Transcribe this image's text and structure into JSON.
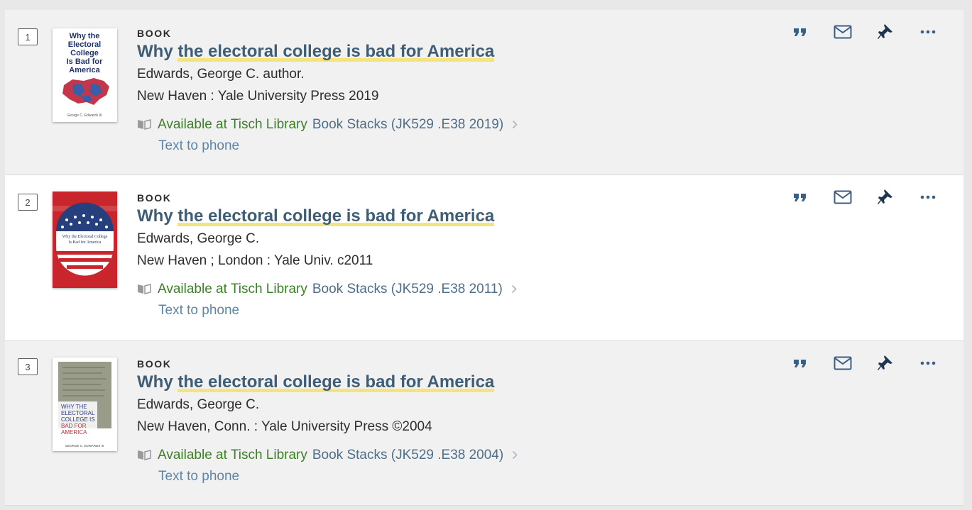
{
  "results": [
    {
      "index": "1",
      "type": "BOOK",
      "title_prefix": "Why ",
      "title_highlight": "the electoral college is bad for America",
      "author": "Edwards, George C. author.",
      "publisher": "New Haven : Yale University Press 2019",
      "availability_status": "Available at Tisch Library",
      "availability_location": "Book Stacks (JK529 .E38 2019)",
      "text_to_phone": "Text to phone"
    },
    {
      "index": "2",
      "type": "BOOK",
      "title_prefix": "Why ",
      "title_highlight": "the electoral college is bad for America",
      "author": "Edwards, George C.",
      "publisher": "New Haven ; London : Yale Univ. c2011",
      "availability_status": "Available at Tisch Library",
      "availability_location": "Book Stacks (JK529 .E38 2011)",
      "text_to_phone": "Text to phone"
    },
    {
      "index": "3",
      "type": "BOOK",
      "title_prefix": "Why ",
      "title_highlight": "the electoral college is bad for America",
      "author": "Edwards, George C.",
      "publisher": "New Haven, Conn. : Yale University Press ©2004",
      "availability_status": "Available at Tisch Library",
      "availability_location": "Book Stacks (JK529 .E38 2004)",
      "text_to_phone": "Text to phone"
    }
  ],
  "covers": {
    "c1_title": [
      "Why the",
      "Electoral",
      "College",
      "Is Bad for",
      "America"
    ],
    "c1_author": "George C. Edwards III",
    "c2_title": [
      "Why the Electoral College",
      "Is Bad for America"
    ],
    "c3_title": [
      "WHY THE",
      "ELECTORAL",
      "COLLEGE IS",
      "BAD FOR",
      "AMERICA"
    ],
    "c3_author": "GEORGE C. EDWARDS III"
  },
  "actions": {
    "cite_icon": "quote-icon",
    "email_icon": "envelope-icon",
    "pin_icon": "pushpin-icon",
    "more_icon": "ellipsis-icon"
  },
  "colors": {
    "title": "#3f5d74",
    "highlight": "#f6e37c",
    "available": "#3c8127",
    "location": "#4f6e88",
    "text_link": "#5c86a8",
    "action_icons": "#3a5f86"
  }
}
